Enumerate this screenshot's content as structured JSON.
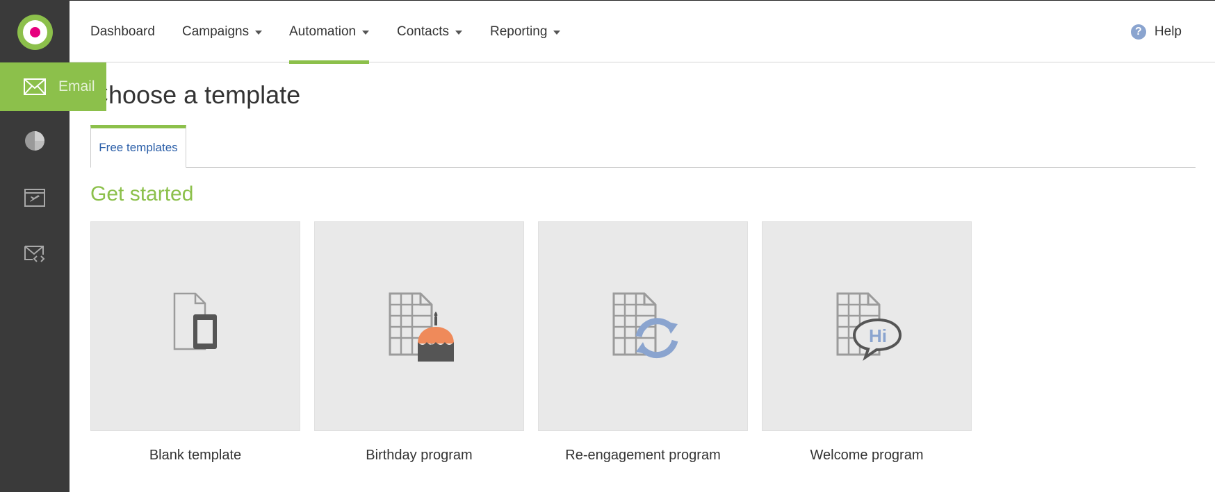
{
  "sidebar": {
    "active_item": {
      "label": "Email",
      "icon": "envelope-icon"
    },
    "items": [
      {
        "icon": "pie-chart-icon"
      },
      {
        "icon": "browser-plane-icon"
      },
      {
        "icon": "envelope-code-icon"
      }
    ],
    "logo_colors": {
      "outer": "#8cc04b",
      "dot": "#e6007e"
    }
  },
  "nav": {
    "items": [
      {
        "label": "Dashboard",
        "dropdown": false,
        "active": false
      },
      {
        "label": "Campaigns",
        "dropdown": true,
        "active": false
      },
      {
        "label": "Automation",
        "dropdown": true,
        "active": true
      },
      {
        "label": "Contacts",
        "dropdown": true,
        "active": false
      },
      {
        "label": "Reporting",
        "dropdown": true,
        "active": false
      }
    ],
    "help_label": "Help"
  },
  "page": {
    "title": "Choose a template",
    "tabs": [
      {
        "label": "Free templates"
      }
    ],
    "section_heading": "Get started",
    "templates": [
      {
        "label": "Blank template",
        "icon": "blank-document-icon"
      },
      {
        "label": "Birthday program",
        "icon": "birthday-cake-document-icon"
      },
      {
        "label": "Re-engagement program",
        "icon": "refresh-document-icon"
      },
      {
        "label": "Welcome program",
        "icon": "hi-speech-document-icon"
      }
    ]
  },
  "colors": {
    "accent": "#8cc04b",
    "sidebar": "#3a3a3a",
    "link": "#2a5ea8",
    "tile": "#e9e9e9",
    "cake": "#ef8a5a",
    "refresh": "#8aa4cf"
  }
}
